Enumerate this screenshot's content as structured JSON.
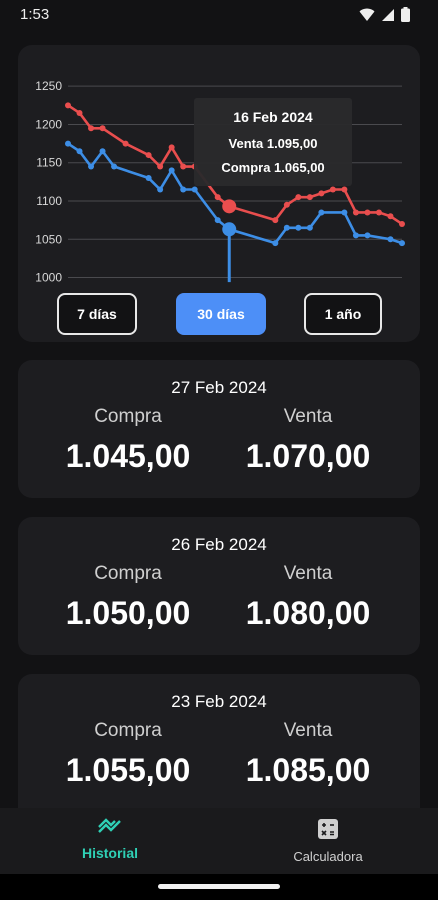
{
  "status_bar": {
    "time": "1:53"
  },
  "chart_data": {
    "type": "line",
    "y_ticks": [
      1250,
      1200,
      1150,
      1100,
      1050,
      1000
    ],
    "ylim": [
      985,
      1262
    ],
    "n_points": 30,
    "series": [
      {
        "name": "Venta",
        "color": "#e94e4e",
        "values": [
          1225,
          1215,
          1195,
          1195,
          1175,
          1160,
          1145,
          1170,
          1145,
          1145,
          1105,
          1093,
          1075,
          1095,
          1105,
          1105,
          1110,
          1115,
          1115,
          1085,
          1085,
          1085,
          1080,
          1070
        ]
      },
      {
        "name": "Compra",
        "color": "#3d8ee6",
        "values": [
          1175,
          1165,
          1145,
          1165,
          1145,
          1130,
          1115,
          1140,
          1115,
          1115,
          1075,
          1063,
          1045,
          1065,
          1065,
          1065,
          1085,
          1085,
          1055,
          1055,
          1050,
          1045
        ]
      }
    ],
    "tooltip": {
      "date": "16 Feb 2024",
      "venta": "Venta 1.095,00",
      "compra": "Compra 1.065,00"
    }
  },
  "range_buttons": {
    "week": "7 días",
    "month": "30 días",
    "year": "1 año"
  },
  "rates": [
    {
      "date": "27 Feb 2024",
      "compra_label": "Compra",
      "venta_label": "Venta",
      "compra": "1.045,00",
      "venta": "1.070,00"
    },
    {
      "date": "26 Feb 2024",
      "compra_label": "Compra",
      "venta_label": "Venta",
      "compra": "1.050,00",
      "venta": "1.080,00"
    },
    {
      "date": "23 Feb 2024",
      "compra_label": "Compra",
      "venta_label": "Venta",
      "compra": "1.055,00",
      "venta": "1.085,00"
    }
  ],
  "nav": {
    "historial": "Historial",
    "calculadora": "Calculadora"
  },
  "colors": {
    "accent": "#2fd0b5",
    "active_button": "#4d8ff7",
    "venta": "#e94e4e",
    "compra": "#3d8ee6"
  }
}
